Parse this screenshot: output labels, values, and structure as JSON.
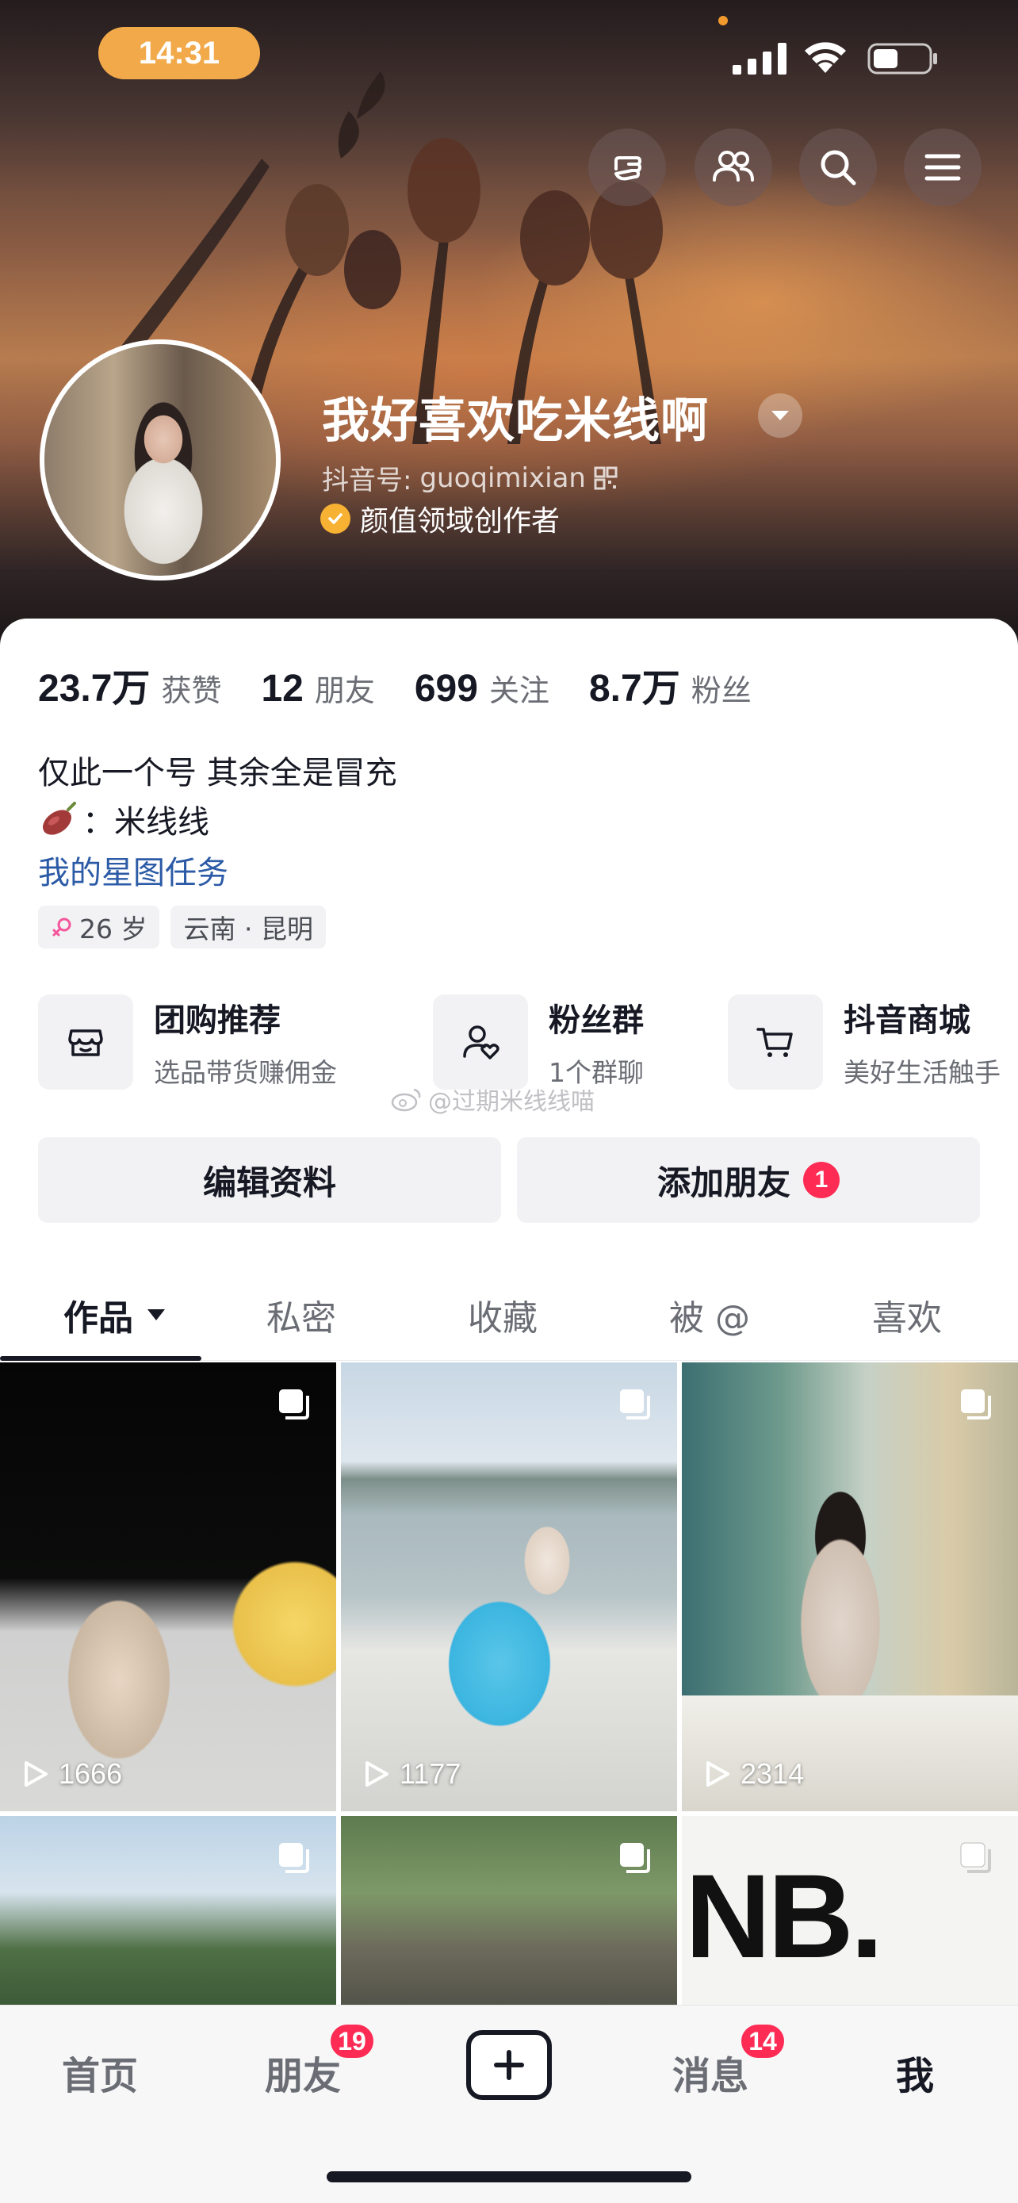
{
  "status_bar": {
    "time": "14:31",
    "icons": [
      "signal-icon",
      "wifi-icon",
      "battery-icon"
    ]
  },
  "header": {
    "top_actions": [
      "tap-hand-icon",
      "friends-icon",
      "search-icon",
      "menu-icon"
    ],
    "username": "我好喜欢吃米线啊",
    "douyin_id_label": "抖音号:",
    "douyin_id": "guoqimixian",
    "creator_tag": "颜值领域创作者"
  },
  "stats": [
    {
      "value": "23.7万",
      "label": "获赞"
    },
    {
      "value": "12",
      "label": "朋友"
    },
    {
      "value": "699",
      "label": "关注"
    },
    {
      "value": "8.7万",
      "label": "粉丝"
    }
  ],
  "bio": {
    "line1": "仅此一个号 其余全是冒充",
    "line2": "：米线线",
    "link": "我的星图任务"
  },
  "tags": {
    "age": "26 岁",
    "location": "云南 · 昆明"
  },
  "services": [
    {
      "title": "团购推荐",
      "sub": "选品带货赚佣金",
      "icon": "store-icon"
    },
    {
      "title": "粉丝群",
      "sub": "1个群聊",
      "icon": "fan-group-icon"
    },
    {
      "title": "抖音商城",
      "sub": "美好生活触手",
      "icon": "cart-icon"
    }
  ],
  "watermark": "@过期米线线喵",
  "buttons": {
    "edit_profile": "编辑资料",
    "add_friend": "添加朋友",
    "add_friend_badge": "1"
  },
  "tabs": [
    "作品",
    "私密",
    "收藏",
    "被 @",
    "喜欢"
  ],
  "videos": [
    {
      "views": "1666"
    },
    {
      "views": "1177"
    },
    {
      "views": "2314"
    },
    {
      "views": ""
    },
    {
      "views": ""
    },
    {
      "views": ""
    }
  ],
  "bottom_nav": {
    "home": "首页",
    "friends": "朋友",
    "friends_badge": "19",
    "messages": "消息",
    "messages_badge": "14",
    "me": "我"
  },
  "colors": {
    "accent_red": "#fe2c55",
    "time_pill": "#f2a94a",
    "link_blue": "#2b5aa6",
    "verified_gold": "#f7b234"
  }
}
